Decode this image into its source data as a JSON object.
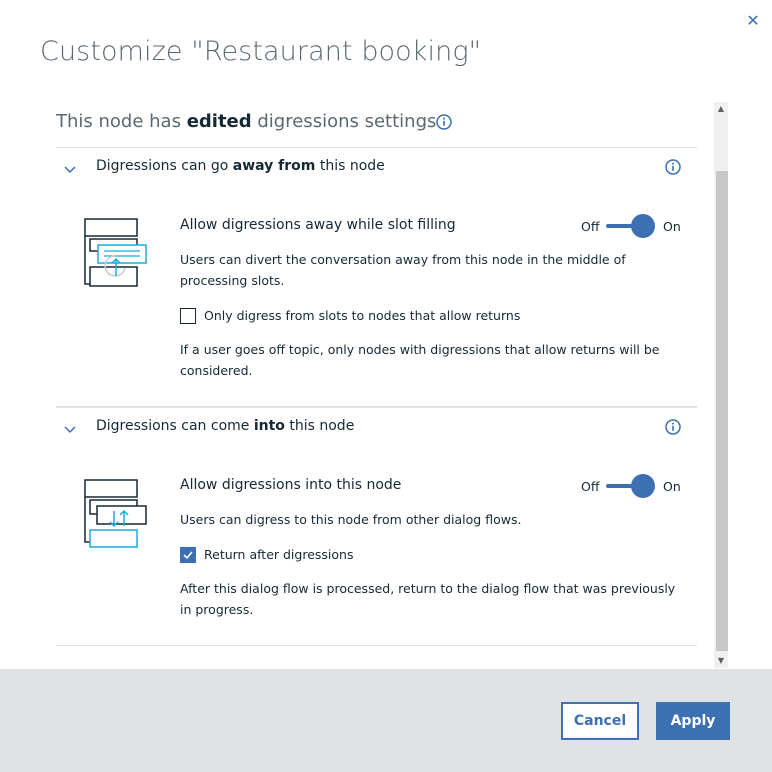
{
  "dialog": {
    "title": "Customize \"Restaurant booking\"",
    "heading": {
      "prefix": "This node has ",
      "emphasis": "edited",
      "suffix": " digressions settings"
    }
  },
  "section_away": {
    "title_prefix": "Digressions can go ",
    "title_emphasis": "away from",
    "title_suffix": " this node",
    "toggle_title": "Allow digressions away while slot filling",
    "toggle_off_label": "Off",
    "toggle_on_label": "On",
    "toggle_state": "on",
    "description": "Users can divert the conversation away from this node in the middle of processing slots.",
    "checkbox_label": "Only digress from slots to nodes that allow returns",
    "checkbox_checked": false,
    "checkbox_description": "If a user goes off topic, only nodes with digressions that allow returns will be considered."
  },
  "section_into": {
    "title_prefix": "Digressions can come ",
    "title_emphasis": "into",
    "title_suffix": " this node",
    "toggle_title": "Allow digressions into this node",
    "toggle_off_label": "Off",
    "toggle_on_label": "On",
    "toggle_state": "on",
    "description": "Users can digress to this node from other dialog flows.",
    "checkbox_label": "Return after digressions",
    "checkbox_checked": true,
    "checkbox_description": "After this dialog flow is processed, return to the dialog flow that was previously in progress."
  },
  "footer": {
    "cancel_label": "Cancel",
    "apply_label": "Apply"
  },
  "colors": {
    "accent": "#3d70b2",
    "text": "#152935",
    "muted": "#5a6872",
    "footer_bg": "#dfe3e6",
    "icon_highlight": "#1aaed6"
  },
  "icons": [
    "close-icon",
    "info-icon",
    "chevron-down-icon",
    "digress-away-icon",
    "digress-into-icon",
    "checkmark-icon"
  ]
}
